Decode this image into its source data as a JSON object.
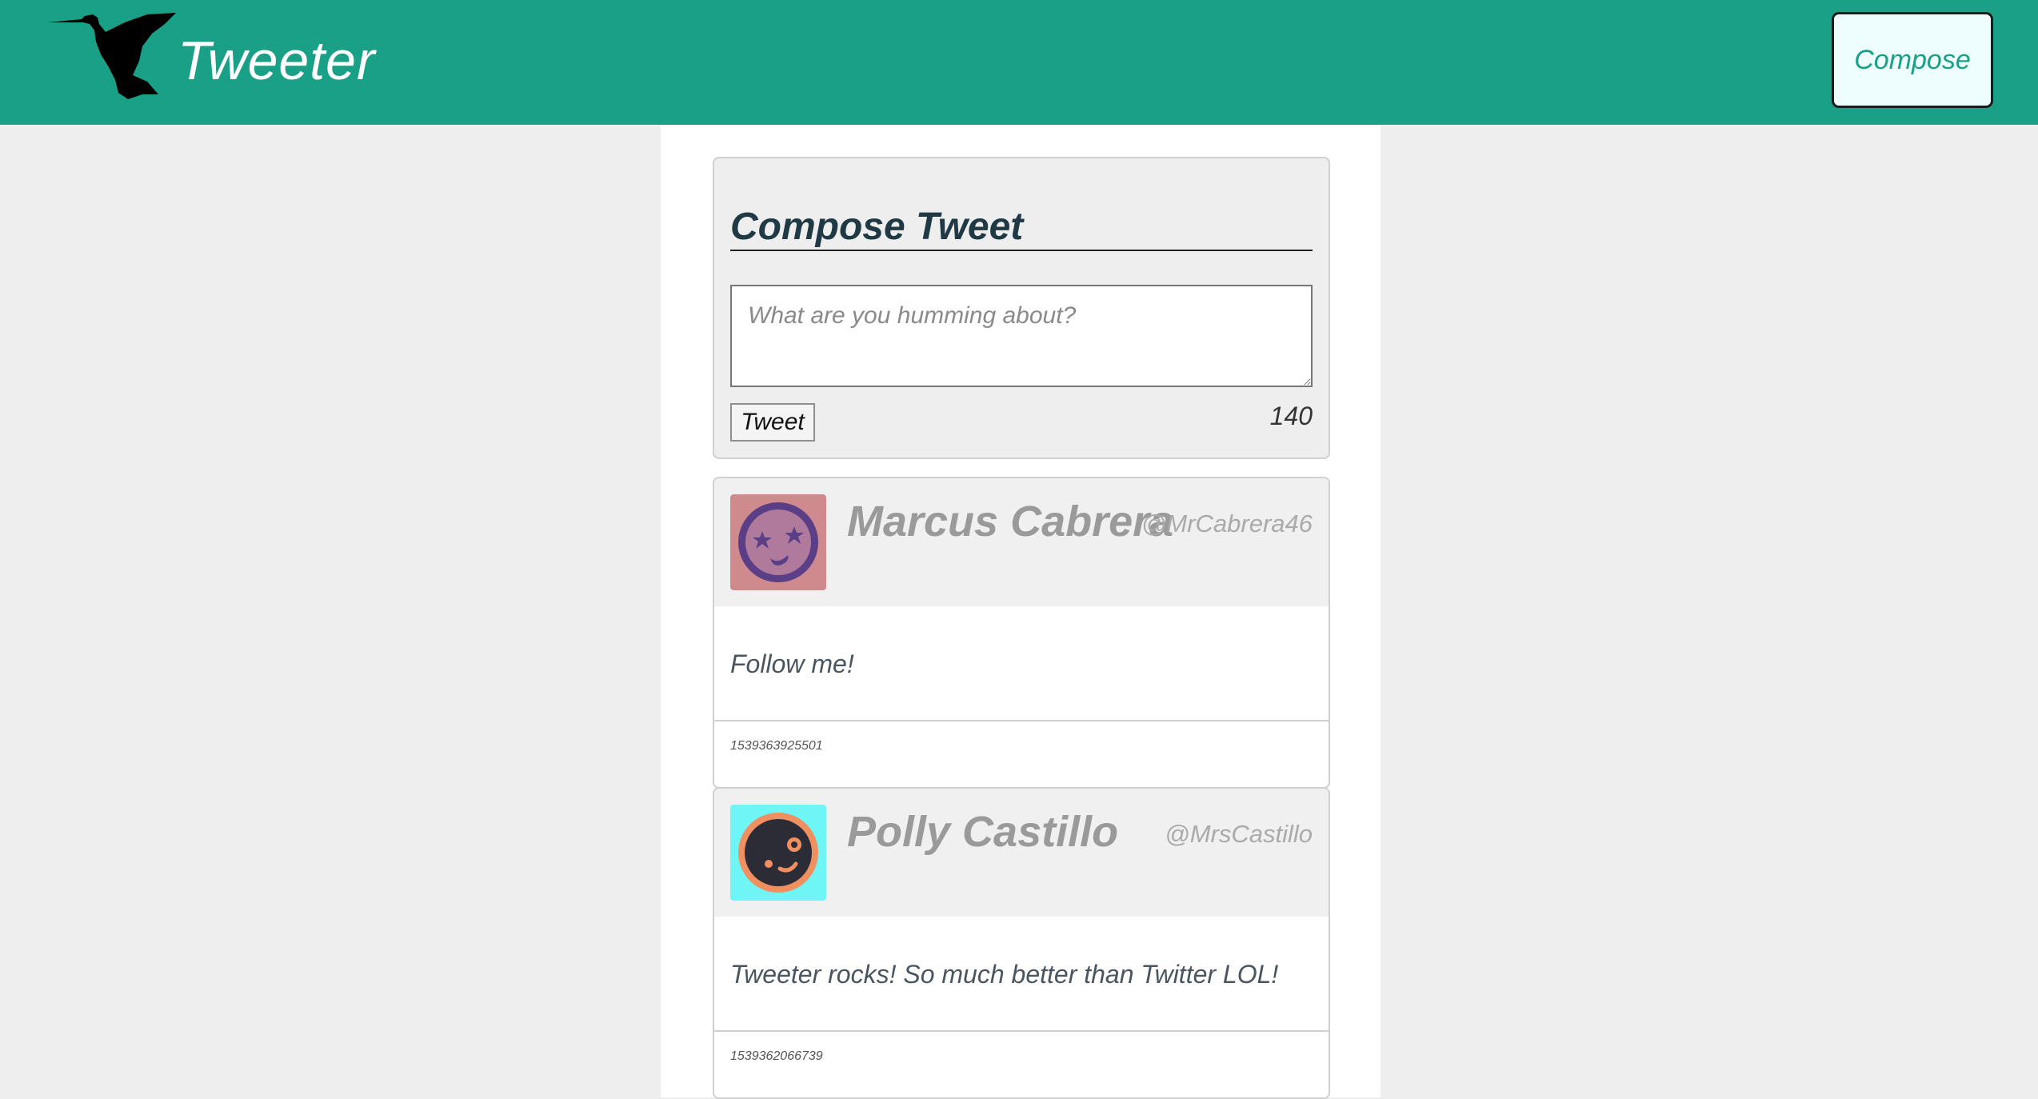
{
  "header": {
    "brand": "Tweeter",
    "compose_label": "Compose",
    "logo_icon": "hummingbird-icon",
    "background_color": "#19a086"
  },
  "compose": {
    "title": "Compose Tweet",
    "placeholder": "What are you humming about?",
    "submit_label": "Tweet",
    "char_count": "140"
  },
  "tweets": [
    {
      "name": "Marcus Cabrera",
      "handle": "@MrCabrera46",
      "content": "Follow me!",
      "timestamp": "1539363925501",
      "avatar_icon": "starry-face-avatar-icon",
      "avatar_bg": "#cf8a8e"
    },
    {
      "name": "Polly Castillo",
      "handle": "@MrsCastillo",
      "content": "Tweeter rocks! So much better than Twitter LOL!",
      "timestamp": "1539362066739",
      "avatar_icon": "smiling-face-avatar-icon",
      "avatar_bg": "#6ff5f5"
    }
  ]
}
